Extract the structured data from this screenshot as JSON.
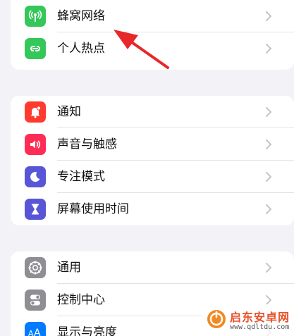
{
  "group1": {
    "items": [
      {
        "label": "蜂窝网络",
        "icon": "cellular-icon",
        "color": "#34c759"
      },
      {
        "label": "个人热点",
        "icon": "hotspot-icon",
        "color": "#34c759"
      }
    ]
  },
  "group2": {
    "items": [
      {
        "label": "通知",
        "icon": "notification-bell-icon",
        "color": "#ff3b30"
      },
      {
        "label": "声音与触感",
        "icon": "speaker-icon",
        "color": "#ff2d55"
      },
      {
        "label": "专注模式",
        "icon": "moon-icon",
        "color": "#5856d6"
      },
      {
        "label": "屏幕使用时间",
        "icon": "hourglass-icon",
        "color": "#5856d6"
      }
    ]
  },
  "group3": {
    "items": [
      {
        "label": "通用",
        "icon": "gear-icon",
        "color": "#8e8e93"
      },
      {
        "label": "控制中心",
        "icon": "toggles-icon",
        "color": "#8e8e93"
      },
      {
        "label": "显示与亮度",
        "icon": "text-size-icon",
        "color": "#007aff"
      }
    ]
  },
  "watermark": {
    "title": "启东安卓网",
    "url": "www.qdltdu.com"
  }
}
